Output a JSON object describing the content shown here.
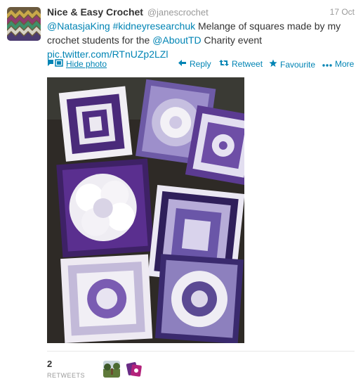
{
  "tweet": {
    "author": {
      "fullname": "Nice & Easy Crochet",
      "username": "@janescrochet"
    },
    "timestamp": "17 Oct",
    "text": {
      "mention1": "@NatasjaKing",
      "hashtag1": "#kidneyresearchuk",
      "part1": " Melange of squares made by my crochet students for the ",
      "mention2": "@AboutTD",
      "part2": " Charity event",
      "pic_link": "pic.twitter.com/RTnUZp2LZl"
    },
    "actions": {
      "hide_photo": "Hide photo",
      "reply": "Reply",
      "retweet": "Retweet",
      "favourite": "Favourite",
      "more": "More"
    },
    "stats": {
      "retweets_count": "2",
      "retweets_label": "RETWEETS"
    }
  },
  "colors": {
    "link": "#0084b4",
    "text": "#333333",
    "muted": "#999999",
    "divider": "#e8e8e8"
  },
  "icons": {
    "photo": "photo-icon",
    "reply": "reply-arrow-icon",
    "retweet": "retweet-icon",
    "favourite": "star-icon",
    "more": "dots-icon"
  }
}
